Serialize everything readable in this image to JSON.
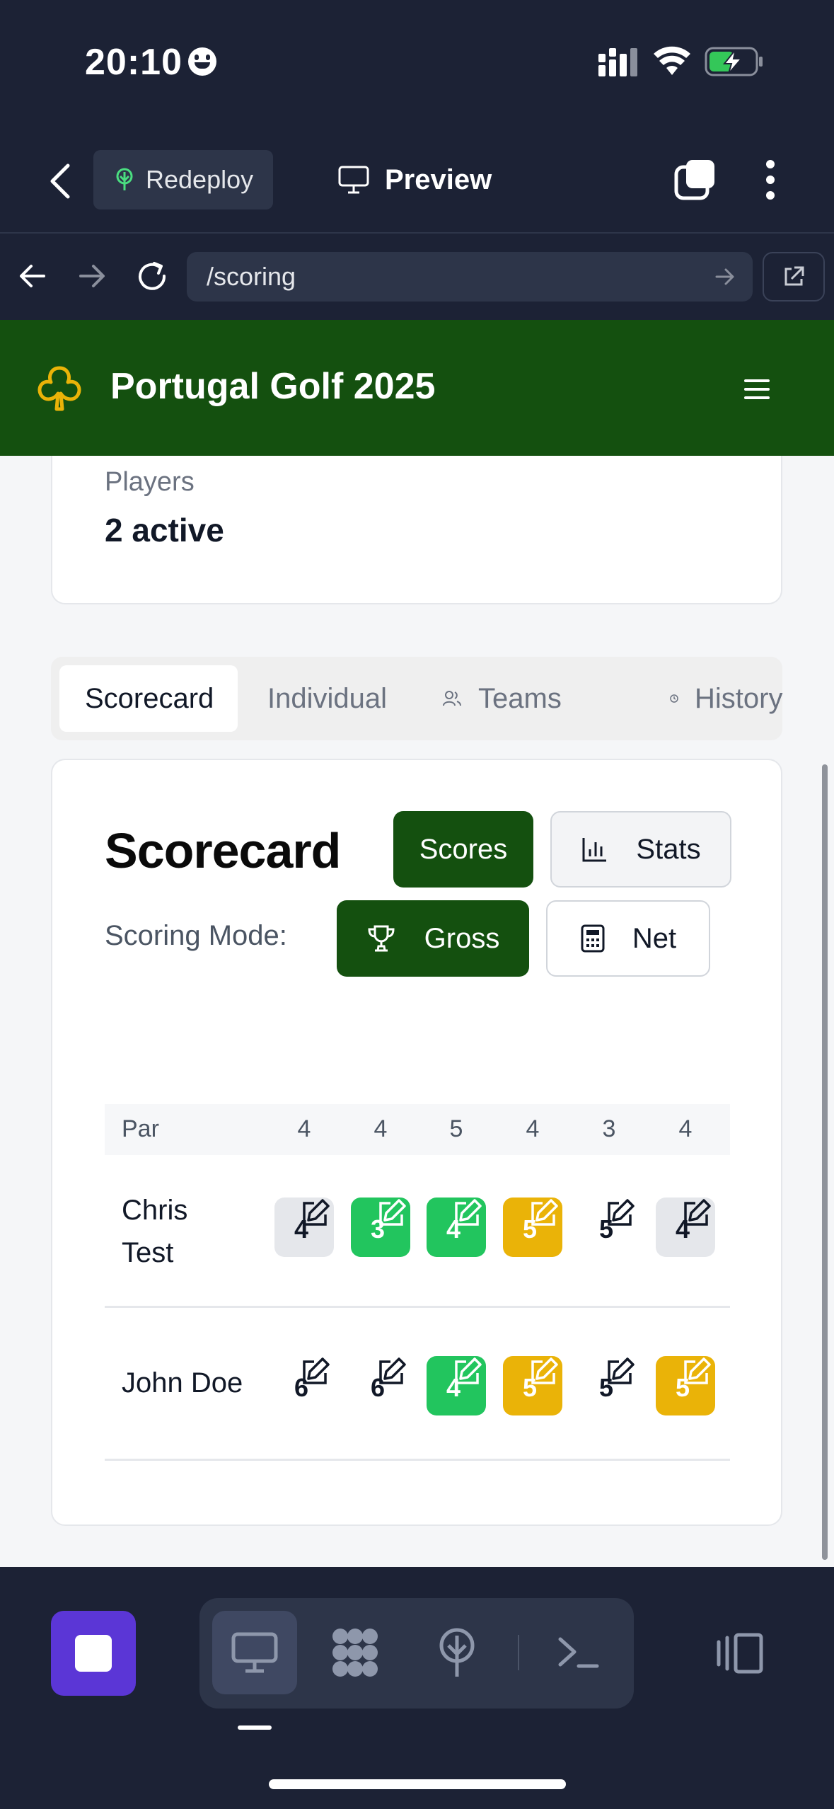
{
  "status_bar": {
    "time": "20:10"
  },
  "app_bar": {
    "redeploy_label": "Redeploy",
    "preview_label": "Preview"
  },
  "browser": {
    "url": "/scoring"
  },
  "site": {
    "title": "Portugal Golf 2025"
  },
  "players_card": {
    "label": "Players",
    "value": "2 active"
  },
  "tabs": [
    {
      "label": "Scorecard",
      "active": true
    },
    {
      "label": "Individual",
      "active": false
    },
    {
      "label": "Teams",
      "active": false
    },
    {
      "label": "History",
      "active": false
    }
  ],
  "scorecard": {
    "title": "Scorecard",
    "view_buttons": {
      "scores": "Scores",
      "stats": "Stats"
    },
    "mode_label": "Scoring Mode:",
    "mode_buttons": {
      "gross": "Gross",
      "net": "Net"
    },
    "par_label": "Par",
    "par": [
      "4",
      "4",
      "5",
      "4",
      "3",
      "4"
    ],
    "players": [
      {
        "name": "Chris Test",
        "scores": [
          "4",
          "3",
          "4",
          "5",
          "5",
          "4"
        ],
        "styles": [
          "gray",
          "green",
          "green",
          "amber",
          "plain",
          "gray"
        ]
      },
      {
        "name": "John Doe",
        "scores": [
          "6",
          "6",
          "4",
          "5",
          "5",
          "5"
        ],
        "styles": [
          "plain",
          "plain",
          "green",
          "amber",
          "plain",
          "amber"
        ]
      }
    ]
  },
  "colors": {
    "header_green": "#14500f",
    "birdie_green": "#22c55e",
    "bogey_amber": "#eab308",
    "par_gray": "#e5e7eb",
    "club_yellow": "#eab308",
    "stop_purple": "#5b36d6"
  },
  "icons": {
    "status": [
      "smiley-icon",
      "signal-icon",
      "wifi-icon",
      "battery-charging-icon"
    ],
    "app_bar": [
      "chevron-left-icon",
      "tree-icon",
      "monitor-icon",
      "tabs-icon",
      "kebab-icon"
    ],
    "browser": [
      "arrow-left-icon",
      "arrow-right-icon",
      "reload-icon",
      "arrow-go-icon",
      "external-link-icon"
    ],
    "site": [
      "club-icon",
      "hamburger-icon"
    ],
    "dock": [
      "stop-icon",
      "monitor-icon",
      "grid-icon",
      "tree-icon",
      "terminal-icon",
      "sidebar-toggle-icon"
    ]
  }
}
